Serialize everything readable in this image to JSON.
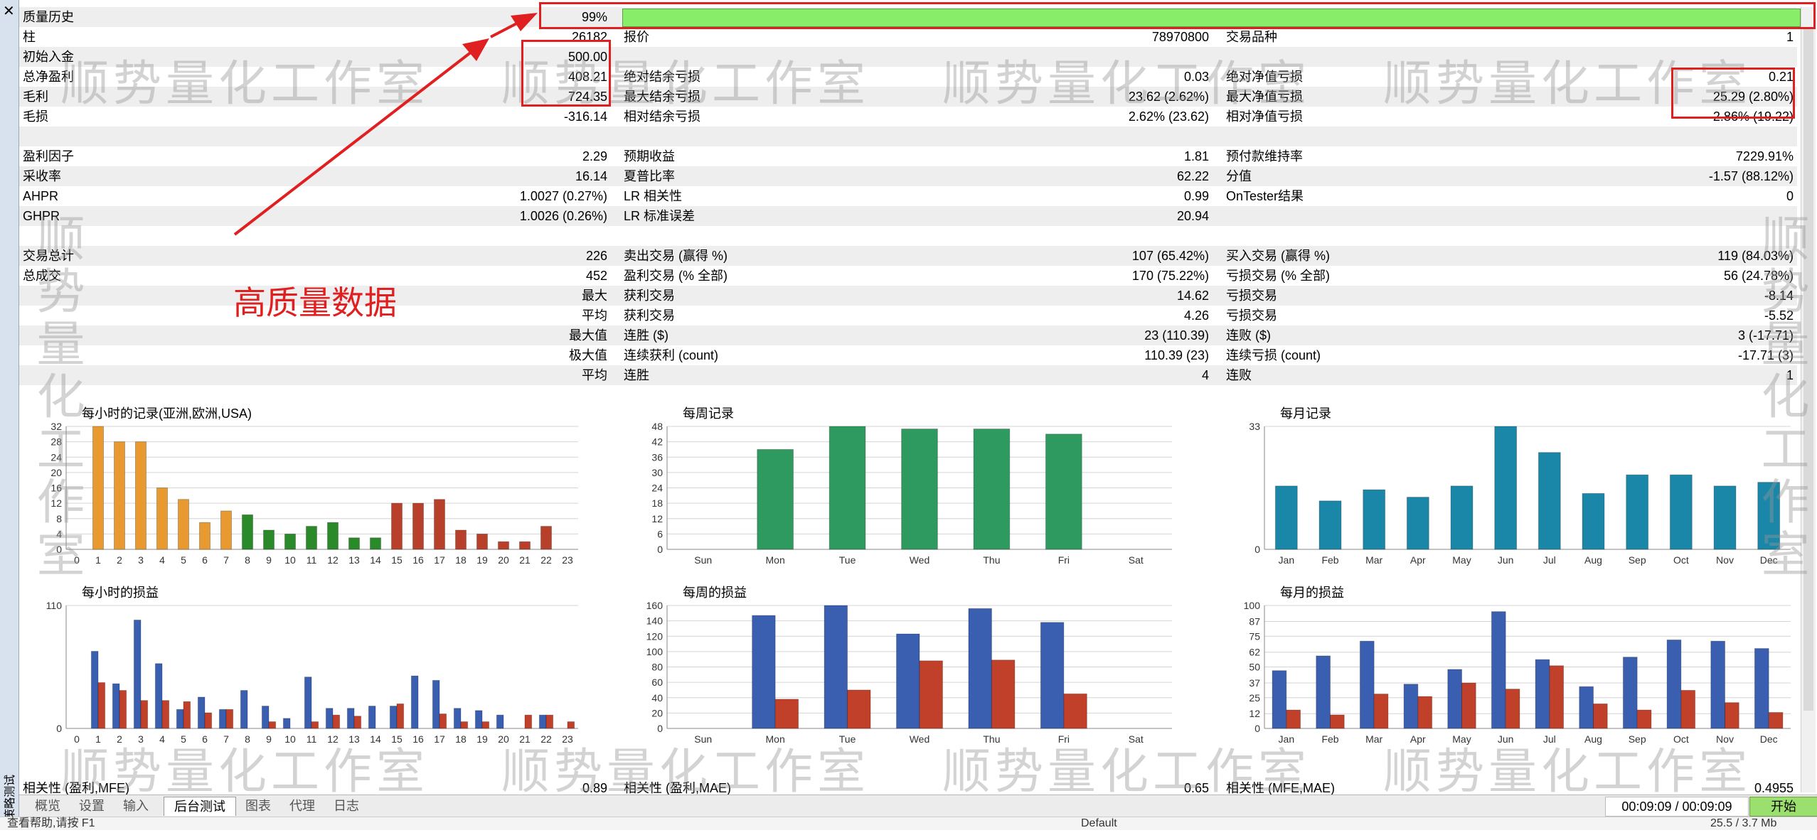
{
  "leftbar": {
    "close": "✕",
    "vertical_label": "策略测试"
  },
  "report": {
    "rows": [
      {
        "l1": "质量历史",
        "v1": "99%",
        "bar": true,
        "shade": true
      },
      {
        "l1": "柱",
        "v1": "26182",
        "l2": "报价",
        "v2": "78970800",
        "l3": "交易品种",
        "v3": "1"
      },
      {
        "l1": "初始入金",
        "v1": "500.00",
        "shade": true
      },
      {
        "l1": "总净盈利",
        "v1": "408.21",
        "l2": "绝对结余亏损",
        "v2": "0.03",
        "l3": "绝对净值亏损",
        "v3": "0.21"
      },
      {
        "l1": "毛利",
        "v1": "724.35",
        "l2": "最大结余亏损",
        "v2": "23.62 (2.62%)",
        "l3": "最大净值亏损",
        "v3": "25.29 (2.80%)",
        "shade": true
      },
      {
        "l1": "毛损",
        "v1": "-316.14",
        "l2": "相对结余亏损",
        "v2": "2.62% (23.62)",
        "l3": "相对净值亏损",
        "v3": "2.86% (19.22)"
      },
      {
        "shade": true
      },
      {
        "l1": "盈利因子",
        "v1": "2.29",
        "l2": "预期收益",
        "v2": "1.81",
        "l3": "预付款维持率",
        "v3": "7229.91%"
      },
      {
        "l1": "采收率",
        "v1": "16.14",
        "l2": "夏普比率",
        "v2": "62.22",
        "l3": "分值",
        "v3": "-1.57 (88.12%)",
        "shade": true
      },
      {
        "l1": "AHPR",
        "v1": "1.0027 (0.27%)",
        "l2": "LR 相关性",
        "v2": "0.99",
        "l3": "OnTester结果",
        "v3": "0"
      },
      {
        "l1": "GHPR",
        "v1": "1.0026 (0.26%)",
        "l2": "LR 标准误差",
        "v2": "20.94",
        "shade": true
      },
      {},
      {
        "l1": "交易总计",
        "v1": "226",
        "l2": "卖出交易 (赢得 %)",
        "v2": "107 (65.42%)",
        "l3": "买入交易 (赢得 %)",
        "v3": "119 (84.03%)",
        "shade": true
      },
      {
        "l1": "总成交",
        "v1": "452",
        "l2": "盈利交易 (% 全部)",
        "v2": "170 (75.22%)",
        "l3": "亏损交易 (% 全部)",
        "v3": "56 (24.78%)"
      },
      {
        "v1": "最大",
        "l2": "获利交易",
        "v2": "14.62",
        "l3": "亏损交易",
        "v3": "-8.14",
        "shade": true
      },
      {
        "v1": "平均",
        "l2": "获利交易",
        "v2": "4.26",
        "l3": "亏损交易",
        "v3": "-5.52"
      },
      {
        "v1": "最大值",
        "l2": "连胜 ($)",
        "v2": "23 (110.39)",
        "l3": "连败 ($)",
        "v3": "3 (-17.71)",
        "shade": true
      },
      {
        "v1": "极大值",
        "l2": "连续获利 (count)",
        "v2": "110.39 (23)",
        "l3": "连续亏损 (count)",
        "v3": "-17.71 (3)"
      },
      {
        "v1": "平均",
        "l2": "连胜",
        "v2": "4",
        "l3": "连败",
        "v3": "1",
        "shade": true
      }
    ],
    "footer_row": {
      "l1": "相关性 (盈利,MFE)",
      "v1": "0.89",
      "l2": "相关性 (盈利,MAE)",
      "v2": "0.65",
      "l3": "相关性 (MFE,MAE)",
      "v3": "0.4955"
    }
  },
  "annotation": {
    "text": "高质量数据",
    "color": "#e02020"
  },
  "watermark": "顺势量化工作室",
  "chart_data": [
    {
      "type": "bar",
      "title": "每小时的记录(亚洲,欧洲,USA)",
      "categories": [
        "0",
        "1",
        "2",
        "3",
        "4",
        "5",
        "6",
        "7",
        "8",
        "9",
        "10",
        "11",
        "12",
        "13",
        "14",
        "15",
        "16",
        "17",
        "18",
        "19",
        "20",
        "21",
        "22",
        "23"
      ],
      "values": [
        0,
        32,
        28,
        28,
        16,
        13,
        7,
        10,
        9,
        5,
        4,
        6,
        7,
        3,
        3,
        12,
        12,
        13,
        5,
        4,
        2,
        2,
        6,
        0
      ],
      "ylim": [
        0,
        32
      ],
      "yticks": [
        0,
        4,
        8,
        12,
        16,
        20,
        24,
        28,
        32
      ],
      "colors": [
        "#e89a30",
        "#e89a30",
        "#e89a30",
        "#e89a30",
        "#e89a30",
        "#e89a30",
        "#e89a30",
        "#e89a30",
        "#2a8a2a",
        "#2a8a2a",
        "#2a8a2a",
        "#2a8a2a",
        "#2a8a2a",
        "#2a8a2a",
        "#2a8a2a",
        "#b8402a",
        "#b8402a",
        "#b8402a",
        "#b8402a",
        "#b8402a",
        "#b8402a",
        "#b8402a",
        "#b8402a",
        "#b8402a"
      ]
    },
    {
      "type": "bar",
      "title": "每周记录",
      "categories": [
        "Sun",
        "Mon",
        "Tue",
        "Wed",
        "Thu",
        "Fri",
        "Sat"
      ],
      "values": [
        0,
        39,
        48,
        47,
        47,
        45,
        0
      ],
      "ylim": [
        0,
        48
      ],
      "yticks": [
        0,
        6,
        12,
        18,
        24,
        30,
        36,
        42,
        48
      ],
      "colors": [
        "#2f9a60"
      ]
    },
    {
      "type": "bar",
      "title": "每月记录",
      "categories": [
        "Jan",
        "Feb",
        "Mar",
        "Apr",
        "May",
        "Jun",
        "Jul",
        "Aug",
        "Sep",
        "Oct",
        "Nov",
        "Dec"
      ],
      "values": [
        17,
        13,
        16,
        14,
        17,
        33,
        26,
        15,
        20,
        20,
        17,
        18
      ],
      "ylim": [
        0,
        33
      ],
      "yticks": [
        0,
        33
      ],
      "colors": [
        "#1a86a8"
      ]
    },
    {
      "type": "bar",
      "title": "每小时的损益",
      "categories": [
        "0",
        "1",
        "2",
        "3",
        "4",
        "5",
        "6",
        "7",
        "8",
        "9",
        "10",
        "11",
        "12",
        "13",
        "14",
        "15",
        "16",
        "17",
        "18",
        "19",
        "20",
        "21",
        "22",
        "23"
      ],
      "series": [
        {
          "values": [
            0,
            69,
            40,
            97,
            58,
            17,
            28,
            17,
            34,
            20,
            9,
            46,
            18,
            18,
            20,
            20,
            47,
            43,
            18,
            16,
            12,
            0,
            12,
            0
          ]
        },
        {
          "values": [
            0,
            41,
            34,
            25,
            25,
            24,
            14,
            17,
            0,
            6,
            0,
            6,
            12,
            11,
            0,
            22,
            0,
            13,
            6,
            6,
            0,
            12,
            12,
            6
          ]
        }
      ],
      "ylim": [
        0,
        110
      ],
      "yticks": [
        0,
        110
      ],
      "colors": [
        "#3a5eb0",
        "#c0402a"
      ]
    },
    {
      "type": "bar",
      "title": "每周的损益",
      "categories": [
        "Sun",
        "Mon",
        "Tue",
        "Wed",
        "Thu",
        "Fri",
        "Sat"
      ],
      "series": [
        {
          "values": [
            0,
            147,
            160,
            123,
            156,
            138,
            0
          ]
        },
        {
          "values": [
            0,
            38,
            50,
            88,
            89,
            45,
            0
          ]
        }
      ],
      "ylim": [
        0,
        160
      ],
      "yticks": [
        0,
        20,
        40,
        60,
        80,
        100,
        120,
        140,
        160
      ],
      "colors": [
        "#3a5eb0",
        "#c0402a"
      ]
    },
    {
      "type": "bar",
      "title": "每月的损益",
      "categories": [
        "Jan",
        "Feb",
        "Mar",
        "Apr",
        "May",
        "Jun",
        "Jul",
        "Aug",
        "Sep",
        "Oct",
        "Nov",
        "Dec"
      ],
      "series": [
        {
          "values": [
            47,
            59,
            71,
            36,
            48,
            95,
            56,
            34,
            58,
            72,
            71,
            65
          ]
        },
        {
          "values": [
            15,
            11,
            28,
            26,
            37,
            32,
            51,
            20,
            15,
            31,
            21,
            13
          ]
        }
      ],
      "ylim": [
        0,
        100
      ],
      "yticks": [
        0,
        12,
        25,
        37,
        50,
        62,
        75,
        87,
        100
      ],
      "colors": [
        "#3a5eb0",
        "#c0402a"
      ]
    }
  ],
  "statusbar": {
    "tabs": [
      "概览",
      "设置",
      "输入",
      "后台测试",
      "图表",
      "代理",
      "日志"
    ],
    "active_tab": "后台测试",
    "timer": "00:09:09 / 00:09:09",
    "start": "开始"
  },
  "bottombar": {
    "left": "查看帮助,请按 F1",
    "mid": "Default",
    "right": "25.5 / 3.7 Mb"
  }
}
